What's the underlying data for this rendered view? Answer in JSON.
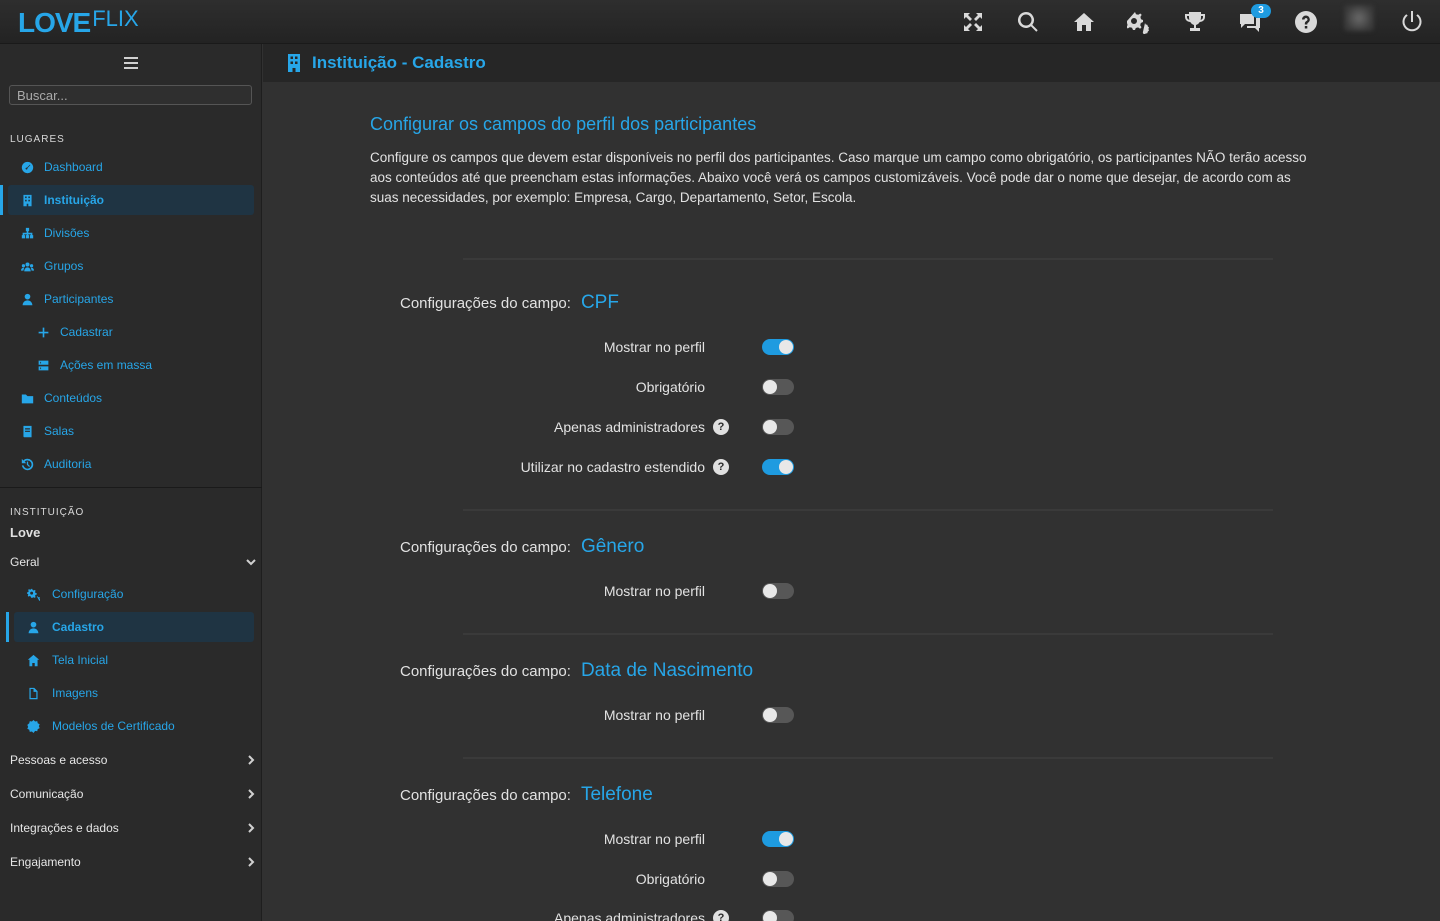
{
  "app": {
    "logo_part1": "LOVE",
    "logo_part2": "FLIX"
  },
  "topbar": {
    "icons": [
      "fullscreen-icon",
      "search-icon",
      "home-icon",
      "settings-icon",
      "trophy-icon",
      "chat-icon",
      "help-icon",
      "avatar",
      "power-icon"
    ],
    "chat_badge": "3"
  },
  "sidebar": {
    "search_placeholder": "Buscar...",
    "places_title": "LUGARES",
    "places": [
      {
        "label": "Dashboard",
        "icon": "dashboard-icon"
      },
      {
        "label": "Instituição",
        "icon": "building-icon",
        "active": true
      },
      {
        "label": "Divisões",
        "icon": "sitemap-icon"
      },
      {
        "label": "Grupos",
        "icon": "users-icon"
      },
      {
        "label": "Participantes",
        "icon": "user-icon"
      },
      {
        "label": "Cadastrar",
        "icon": "plus-icon",
        "indent": true
      },
      {
        "label": "Ações em massa",
        "icon": "tasks-icon",
        "indent": true
      },
      {
        "label": "Conteúdos",
        "icon": "folder-icon"
      },
      {
        "label": "Salas",
        "icon": "book-icon"
      },
      {
        "label": "Auditoria",
        "icon": "history-icon"
      }
    ],
    "institution_title": "INSTITUIÇÃO",
    "institution_name": "Love",
    "general_label": "Geral",
    "general_items": [
      {
        "label": "Configuração",
        "icon": "cogs-icon"
      },
      {
        "label": "Cadastro",
        "icon": "user-icon",
        "active": true
      },
      {
        "label": "Tela Inicial",
        "icon": "home-icon"
      },
      {
        "label": "Imagens",
        "icon": "file-icon"
      },
      {
        "label": "Modelos de Certificado",
        "icon": "certificate-icon"
      }
    ],
    "groups": [
      "Pessoas e acesso",
      "Comunicação",
      "Integrações e dados",
      "Engajamento"
    ]
  },
  "page": {
    "title": "Instituição - Cadastro",
    "section_heading": "Configurar os campos do perfil dos participantes",
    "section_description": "Configure os campos que devem estar disponíveis no perfil dos participantes. Caso marque um campo como obrigatório, os participantes NÃO terão acesso aos conteúdos até que preencham estas informações. Abaixo você verá os campos customizáveis. Você pode dar o nome que desejar, de acordo com as suas necessidades, por exemplo: Empresa, Cargo, Departamento, Setor, Escola.",
    "field_label_prefix": "Configurações do campo:",
    "fields": [
      {
        "name": "CPF",
        "options": [
          {
            "label": "Mostrar no perfil",
            "on": true,
            "help": false
          },
          {
            "label": "Obrigatório",
            "on": false,
            "help": false
          },
          {
            "label": "Apenas administradores",
            "on": false,
            "help": true
          },
          {
            "label": "Utilizar no cadastro estendido",
            "on": true,
            "help": true
          }
        ]
      },
      {
        "name": "Gênero",
        "options": [
          {
            "label": "Mostrar no perfil",
            "on": false,
            "help": false
          }
        ]
      },
      {
        "name": "Data de Nascimento",
        "options": [
          {
            "label": "Mostrar no perfil",
            "on": false,
            "help": false
          }
        ]
      },
      {
        "name": "Telefone",
        "options": [
          {
            "label": "Mostrar no perfil",
            "on": true,
            "help": false
          },
          {
            "label": "Obrigatório",
            "on": false,
            "help": false
          },
          {
            "label": "Apenas administradores",
            "on": false,
            "help": true
          }
        ]
      }
    ],
    "help_glyph": "?"
  },
  "colors": {
    "accent": "#27a6e8",
    "toggle_on": "#1e9be0",
    "toggle_off": "#575757",
    "background": "#313131"
  }
}
